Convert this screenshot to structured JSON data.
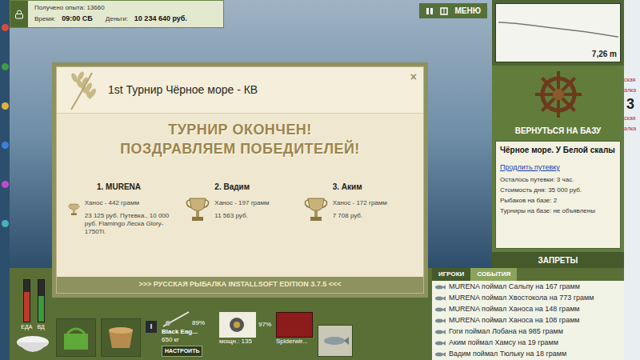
{
  "status": {
    "experience": "Получено опыта: 13660",
    "time_label": "Время:",
    "time": "09:00 СБ",
    "money_label": "Деньги:",
    "money": "10 234 640 руб."
  },
  "toolbar": {
    "menu": "МЕНЮ"
  },
  "depth_chart": {
    "reading": "7,26 m",
    "values": [
      6.9,
      6.93,
      6.98,
      7.03,
      7.08,
      7.13,
      7.19,
      7.26
    ]
  },
  "return_button": "ВЕРНУТЬСЯ НА БАЗУ",
  "location": {
    "title": "Чёрное море. У Белой скалы",
    "extend_link": "Продлить путевку",
    "lines": [
      "Осталось путевки: 3 час.",
      "Стоимость дня: 35 000 руб.",
      "Рыбаков на базе: 2",
      "Турниры на базе: не объявлены"
    ]
  },
  "bans_button": "ЗАПРЕТЫ",
  "event_tabs": [
    {
      "label": "ИГРОКИ",
      "selected": false
    },
    {
      "label": "СОБЫТИЯ",
      "selected": true
    }
  ],
  "events": [
    "MURENA поймал Сальпу на 167 грамм",
    "MURENA поймал Хвостокола на 773 грамм",
    "MURENA поймал Ханоса на 148 грамм",
    "MURENA поймал Ханоса на 108 грамм",
    "Гоги поймал Лобана на 985 грамм",
    "Аким поймал Хамсу на 19 грамм",
    "Вадим поймал Тюльку на 18 грамм"
  ],
  "dialog": {
    "title": "1st Турнир Чёрное море - КВ",
    "close": "×",
    "heading": [
      "ТУРНИР ОКОНЧЕН!",
      "ПОЗДРАВЛЯЕМ ПОБЕДИТЕЛЕЙ!"
    ],
    "winners": [
      {
        "place": "1. MURENA",
        "catch": "Ханос - 442 грамм",
        "prize": "23 125 руб. Путевка., 10 000 руб. Flamingo Леска Glory-1750Ti."
      },
      {
        "place": "2. Вадим",
        "catch": "Ханос - 197 грамм",
        "prize": "11 563 руб."
      },
      {
        "place": "3. Аким",
        "catch": "Ханос - 172 грамм",
        "prize": "7 708 руб."
      }
    ],
    "footer": ">>> РУССКАЯ РЫБАЛКА INSTALLSOFT EDITION 3.7.5 <<<"
  },
  "controls": {
    "gauges": [
      {
        "label": "ЕДА",
        "level": 0.7,
        "color": "#c0392b"
      },
      {
        "label": "ВД",
        "level": 0.6,
        "color": "#3c9a3c"
      }
    ],
    "slot_button": "I",
    "rod": {
      "wear": "89%",
      "name": "Black Eag...",
      "load": "650 кг",
      "setup_button": "НАСТРОИТЬ"
    },
    "reel": {
      "power": "мощн.: 135",
      "wear": "97%"
    },
    "line": {
      "name": "Spiderwir..."
    }
  },
  "desktop": {
    "fragments": [
      "ская",
      "алка",
      "3",
      "ская",
      "алка"
    ]
  }
}
